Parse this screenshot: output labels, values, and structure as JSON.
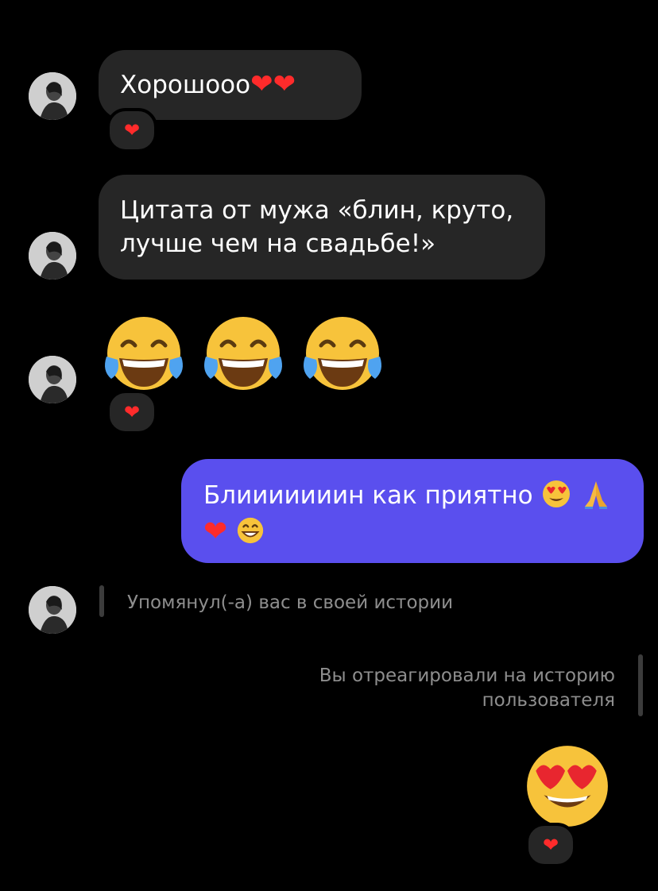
{
  "messages": [
    {
      "type": "incoming",
      "text": "Хорошооо",
      "emoji": [
        "heart",
        "heart"
      ],
      "reaction": "heart"
    },
    {
      "type": "incoming",
      "text_line1": "Цитата от мужа «блин, круто,",
      "text_line2": "лучше чем на свадьбе!»"
    },
    {
      "type": "incoming",
      "emoji": [
        "face-with-tears-of-joy",
        "face-with-tears-of-joy",
        "face-with-tears-of-joy"
      ],
      "reaction": "heart"
    },
    {
      "type": "outgoing",
      "text": "Блииииииин как приятно",
      "emoji_line1": [
        "smiling-face-with-heart-eyes",
        "folded-hands"
      ],
      "emoji_line2": [
        "heart",
        "grinning-face-with-smiling-eyes"
      ]
    }
  ],
  "story_mention": {
    "text": "Упомянул(-а) вас в своей истории"
  },
  "story_reaction": {
    "line1": "Вы отреагировали на историю",
    "line2": "пользователя"
  },
  "final_emoji": {
    "emoji": "smiling-face-with-heart-eyes",
    "reaction": "heart"
  },
  "glyphs": {
    "heart": "❤"
  },
  "colors": {
    "background": "#000000",
    "incoming_bubble": "#262626",
    "outgoing_bubble": "#5a4fee",
    "meta_text": "#8e8e8e",
    "heart": "#ff2b2b"
  }
}
